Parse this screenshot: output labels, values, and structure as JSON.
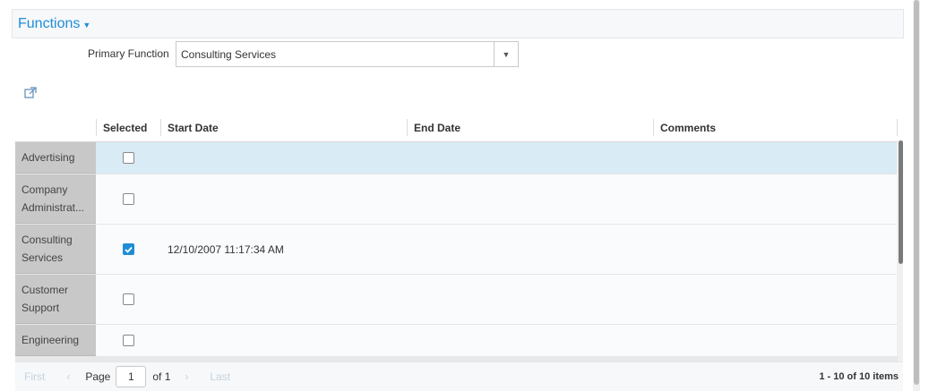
{
  "section": {
    "title": "Functions"
  },
  "primary_function": {
    "label": "Primary Function",
    "value": "Consulting Services"
  },
  "grid": {
    "columns": [
      "Selected",
      "Start Date",
      "End Date",
      "Comments"
    ],
    "rows": [
      {
        "name": "Advertising",
        "selected": false,
        "start": "",
        "end": "",
        "comments": ""
      },
      {
        "name": "Company Administrat...",
        "selected": false,
        "start": "",
        "end": "",
        "comments": ""
      },
      {
        "name": "Consulting Services",
        "selected": true,
        "start": "12/10/2007 11:17:34 AM",
        "end": "",
        "comments": ""
      },
      {
        "name": "Customer Support",
        "selected": false,
        "start": "",
        "end": "",
        "comments": ""
      },
      {
        "name": "Engineering",
        "selected": false,
        "start": "",
        "end": "",
        "comments": ""
      }
    ]
  },
  "pager": {
    "first": "First",
    "page_label": "Page",
    "page": "1",
    "of": "of 1",
    "last": "Last",
    "count": "1 - 10 of 10 items"
  },
  "colors": {
    "accent": "#1f8dd6",
    "selected_row": "#d9ebf4",
    "row_header": "#c8c8c8"
  }
}
